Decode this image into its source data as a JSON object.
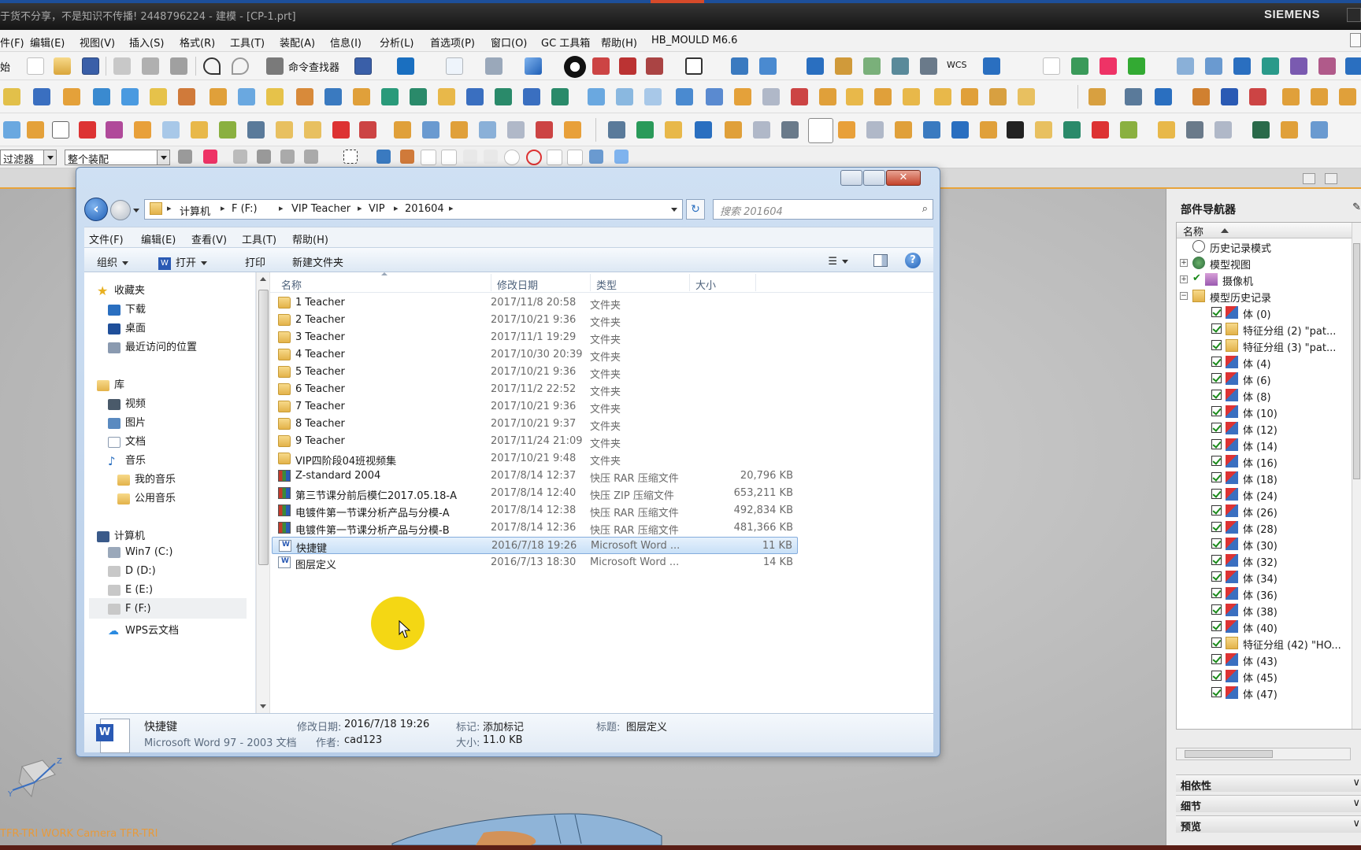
{
  "nx": {
    "title": "于货不分享，不是知识不传播! 2448796224 - 建模 - [CP-1.prt]",
    "brand": "SIEMENS",
    "menu": [
      "件(F)",
      "编辑(E)",
      "视图(V)",
      "插入(S)",
      "格式(R)",
      "工具(T)",
      "装配(A)",
      "信息(I)",
      "分析(L)",
      "首选项(P)",
      "窗口(O)",
      "GC 工具箱",
      "帮助(H)",
      "HB_MOULD M6.6"
    ],
    "toolbar": {
      "start_label": "始",
      "command_finder": "命令查找器",
      "wcs_label": "WCS"
    },
    "filter": {
      "type_filter": "过滤器",
      "scope": "整个装配"
    },
    "viewport_status": "TFR-TRI WORK Camera TFR-TRI",
    "accent_color": "#e8a33a"
  },
  "part_navigator": {
    "title": "部件导航器",
    "column_header": "名称",
    "rows": [
      {
        "label": "历史记录模式",
        "indent": 0,
        "kind": "clock"
      },
      {
        "label": "模型视图",
        "indent": 0,
        "kind": "views",
        "expand": "+"
      },
      {
        "label": "摄像机",
        "indent": 0,
        "kind": "camera",
        "expand": "+"
      },
      {
        "label": "模型历史记录",
        "indent": 0,
        "kind": "folder",
        "expand": "−"
      },
      {
        "label": "体 (0)",
        "indent": 1,
        "kind": "body"
      },
      {
        "label": "特征分组 (2) \"pat...",
        "indent": 1,
        "kind": "group"
      },
      {
        "label": "特征分组 (3) \"pat...",
        "indent": 1,
        "kind": "group"
      },
      {
        "label": "体 (4)",
        "indent": 1,
        "kind": "body"
      },
      {
        "label": "体 (6)",
        "indent": 1,
        "kind": "body"
      },
      {
        "label": "体 (8)",
        "indent": 1,
        "kind": "body"
      },
      {
        "label": "体 (10)",
        "indent": 1,
        "kind": "body"
      },
      {
        "label": "体 (12)",
        "indent": 1,
        "kind": "body"
      },
      {
        "label": "体 (14)",
        "indent": 1,
        "kind": "body"
      },
      {
        "label": "体 (16)",
        "indent": 1,
        "kind": "body"
      },
      {
        "label": "体 (18)",
        "indent": 1,
        "kind": "body"
      },
      {
        "label": "体 (24)",
        "indent": 1,
        "kind": "body"
      },
      {
        "label": "体 (26)",
        "indent": 1,
        "kind": "body"
      },
      {
        "label": "体 (28)",
        "indent": 1,
        "kind": "body"
      },
      {
        "label": "体 (30)",
        "indent": 1,
        "kind": "body"
      },
      {
        "label": "体 (32)",
        "indent": 1,
        "kind": "body"
      },
      {
        "label": "体 (34)",
        "indent": 1,
        "kind": "body"
      },
      {
        "label": "体 (36)",
        "indent": 1,
        "kind": "body"
      },
      {
        "label": "体 (38)",
        "indent": 1,
        "kind": "body"
      },
      {
        "label": "体 (40)",
        "indent": 1,
        "kind": "body"
      },
      {
        "label": "特征分组 (42) \"HO...",
        "indent": 1,
        "kind": "group"
      },
      {
        "label": "体 (43)",
        "indent": 1,
        "kind": "body"
      },
      {
        "label": "体 (45)",
        "indent": 1,
        "kind": "body"
      },
      {
        "label": "体 (47)",
        "indent": 1,
        "kind": "body"
      }
    ],
    "sections": [
      "相依性",
      "细节",
      "预览"
    ]
  },
  "explorer": {
    "breadcrumb": [
      "计算机",
      "F (F:)",
      "VIP Teacher",
      "VIP",
      "201604"
    ],
    "search_placeholder": "搜索 201604",
    "menu": [
      "文件(F)",
      "编辑(E)",
      "查看(V)",
      "工具(T)",
      "帮助(H)"
    ],
    "commands": {
      "organize": "组织",
      "open": "打开",
      "print": "打印",
      "new_folder": "新建文件夹"
    },
    "tree": {
      "favorites": "收藏夹",
      "favorites_items": [
        "下载",
        "桌面",
        "最近访问的位置"
      ],
      "libraries": "库",
      "library_items": [
        "视频",
        "图片",
        "文档",
        "音乐"
      ],
      "music_items": [
        "我的音乐",
        "公用音乐"
      ],
      "computer": "计算机",
      "drives": [
        "Win7 (C:)",
        "D (D:)",
        "E (E:)",
        "F (F:)",
        "WPS云文档"
      ]
    },
    "columns": {
      "name": "名称",
      "date": "修改日期",
      "type": "类型",
      "size": "大小"
    },
    "files": [
      {
        "name": "1 Teacher",
        "date": "2017/11/8 20:58",
        "type": "文件夹",
        "size": "",
        "icon": "folder"
      },
      {
        "name": "2 Teacher",
        "date": "2017/10/21 9:36",
        "type": "文件夹",
        "size": "",
        "icon": "folder"
      },
      {
        "name": "3 Teacher",
        "date": "2017/11/1 19:29",
        "type": "文件夹",
        "size": "",
        "icon": "folder"
      },
      {
        "name": "4 Teacher",
        "date": "2017/10/30 20:39",
        "type": "文件夹",
        "size": "",
        "icon": "folder"
      },
      {
        "name": "5 Teacher",
        "date": "2017/10/21 9:36",
        "type": "文件夹",
        "size": "",
        "icon": "folder"
      },
      {
        "name": "6 Teacher",
        "date": "2017/11/2 22:52",
        "type": "文件夹",
        "size": "",
        "icon": "folder"
      },
      {
        "name": "7 Teacher",
        "date": "2017/10/21 9:36",
        "type": "文件夹",
        "size": "",
        "icon": "folder"
      },
      {
        "name": "8 Teacher",
        "date": "2017/10/21 9:37",
        "type": "文件夹",
        "size": "",
        "icon": "folder"
      },
      {
        "name": "9 Teacher",
        "date": "2017/11/24 21:09",
        "type": "文件夹",
        "size": "",
        "icon": "folder"
      },
      {
        "name": "VIP四阶段04班视频集",
        "date": "2017/10/21 9:48",
        "type": "文件夹",
        "size": "",
        "icon": "folder"
      },
      {
        "name": "Z-standard 2004",
        "date": "2017/8/14 12:37",
        "type": "快压 RAR 压缩文件",
        "size": "20,796 KB",
        "icon": "rar"
      },
      {
        "name": "第三节课分前后模仁2017.05.18-A",
        "date": "2017/8/14 12:40",
        "type": "快压 ZIP 压缩文件",
        "size": "653,211 KB",
        "icon": "rar"
      },
      {
        "name": "电镀件第一节课分析产品与分模-A",
        "date": "2017/8/14 12:38",
        "type": "快压 RAR 压缩文件",
        "size": "492,834 KB",
        "icon": "rar"
      },
      {
        "name": "电镀件第一节课分析产品与分模-B",
        "date": "2017/8/14 12:36",
        "type": "快压 RAR 压缩文件",
        "size": "481,366 KB",
        "icon": "rar"
      },
      {
        "name": "快捷键",
        "date": "2016/7/18 19:26",
        "type": "Microsoft Word ...",
        "size": "11 KB",
        "icon": "doc",
        "selected": true
      },
      {
        "name": "图层定义",
        "date": "2016/7/13 18:30",
        "type": "Microsoft Word ...",
        "size": "14 KB",
        "icon": "doc"
      }
    ],
    "details": {
      "name": "快捷键",
      "file_type": "Microsoft Word 97 - 2003 文档",
      "modified_label": "修改日期:",
      "modified": "2016/7/18 19:26",
      "author_label": "作者:",
      "author": "cad123",
      "tags_label": "标记:",
      "tags": "添加标记",
      "size_label": "大小:",
      "size": "11.0 KB",
      "title_label": "标题:",
      "title": "图层定义"
    }
  }
}
